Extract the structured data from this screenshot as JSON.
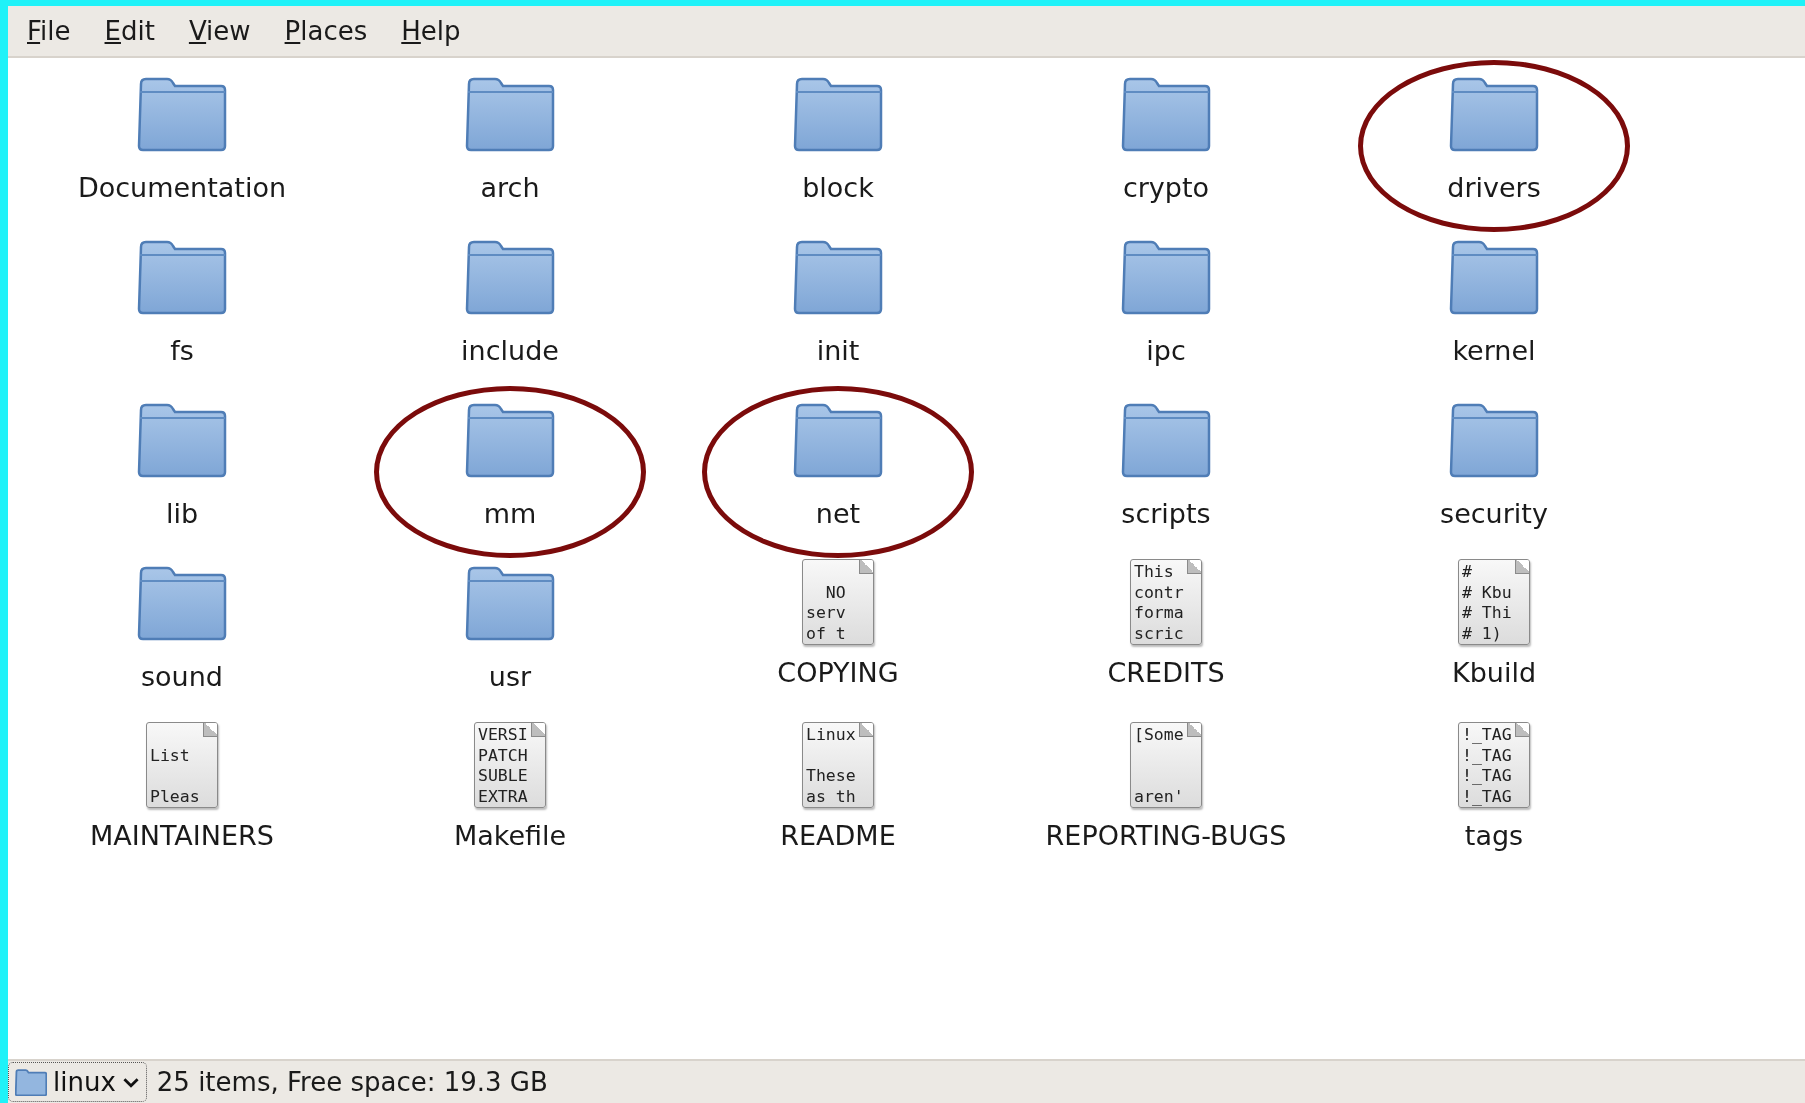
{
  "menu": [
    "File",
    "Edit",
    "View",
    "Places",
    "Help"
  ],
  "items": [
    {
      "name": "Documentation",
      "kind": "folder",
      "circled": false
    },
    {
      "name": "arch",
      "kind": "folder",
      "circled": false
    },
    {
      "name": "block",
      "kind": "folder",
      "circled": false
    },
    {
      "name": "crypto",
      "kind": "folder",
      "circled": false
    },
    {
      "name": "drivers",
      "kind": "folder",
      "circled": true
    },
    {
      "name": "fs",
      "kind": "folder",
      "circled": false
    },
    {
      "name": "include",
      "kind": "folder",
      "circled": false
    },
    {
      "name": "init",
      "kind": "folder",
      "circled": false
    },
    {
      "name": "ipc",
      "kind": "folder",
      "circled": false
    },
    {
      "name": "kernel",
      "kind": "folder",
      "circled": false
    },
    {
      "name": "lib",
      "kind": "folder",
      "circled": false
    },
    {
      "name": "mm",
      "kind": "folder",
      "circled": true
    },
    {
      "name": "net",
      "kind": "folder",
      "circled": true
    },
    {
      "name": "scripts",
      "kind": "folder",
      "circled": false
    },
    {
      "name": "security",
      "kind": "folder",
      "circled": false
    },
    {
      "name": "sound",
      "kind": "folder",
      "circled": false
    },
    {
      "name": "usr",
      "kind": "folder",
      "circled": false
    },
    {
      "name": "COPYING",
      "kind": "text",
      "preview": "\n  NO\nserv\nof t",
      "circled": false
    },
    {
      "name": "CREDITS",
      "kind": "text",
      "preview": "This\ncontr\nforma\nscric",
      "circled": false
    },
    {
      "name": "Kbuild",
      "kind": "text",
      "preview": "#\n# Kbu\n# Thi\n# 1)",
      "circled": false
    },
    {
      "name": "MAINTAINERS",
      "kind": "text",
      "preview": "\nList\n\nPleas",
      "circled": false
    },
    {
      "name": "Makefile",
      "kind": "text",
      "preview": "VERSI\nPATCH\nSUBLE\nEXTRA",
      "circled": false
    },
    {
      "name": "README",
      "kind": "text",
      "preview": "Linux\n\nThese\nas th",
      "circled": false
    },
    {
      "name": "REPORTING-BUGS",
      "kind": "text",
      "preview": "[Some\n\n\naren'",
      "circled": false
    },
    {
      "name": "tags",
      "kind": "text",
      "preview": "!_TAG\n!_TAG\n!_TAG\n!_TAG",
      "circled": false
    }
  ],
  "status_bar": {
    "location": "linux",
    "info": "25 items, Free space: 19.3 GB"
  }
}
